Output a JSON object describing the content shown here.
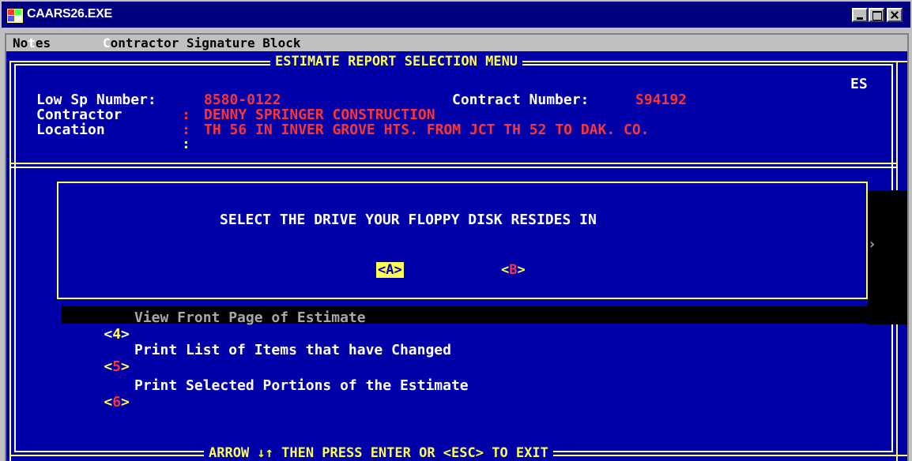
{
  "window": {
    "title": "CAARS26.EXE",
    "icon": "ms-dos-icon",
    "controls": [
      "minimize",
      "maximize",
      "close"
    ]
  },
  "menubar": {
    "notes": {
      "before": "No",
      "hotkey": "t",
      "after": "es"
    },
    "signature": {
      "hotkey": "C",
      "after": "ontractor Signature Block"
    }
  },
  "screen": {
    "title": " ESTIMATE REPORT SELECTION MENU ",
    "code": "ES",
    "footer": " ARROW ↓↑ THEN PRESS ENTER OR <ESC> TO EXIT "
  },
  "header": {
    "low_sp_label": "Low Sp Number:",
    "low_sp_value": "8580-0122",
    "contract_label": "Contract Number:",
    "contract_value": "S94192",
    "contractor_label": "Contractor",
    "contractor_sep": ":",
    "contractor_value": "DENNY SPRINGER CONSTRUCTION",
    "location_label": "Location",
    "location_sep": ":",
    "location_value": "TH 56 IN INVER GROVE HTS. FROM JCT TH 52 TO DAK. CO.",
    "extra_sep": ":"
  },
  "dialog": {
    "prompt": "SELECT THE DRIVE YOUR FLOPPY DISK RESIDES IN",
    "option_a": {
      "open": "<",
      "key": "A",
      "close": ">"
    },
    "option_b": {
      "open": "<",
      "key": "B",
      "close": ">"
    }
  },
  "menu_items": [
    {
      "open": "<",
      "key": "4",
      "close": ">",
      "label": "View Front Page of Estimate",
      "state": "disabled"
    },
    {
      "open": "<",
      "key": "5",
      "close": ">",
      "label": "Print List of Items that have Changed"
    },
    {
      "open": "<",
      "key": "6",
      "close": ">",
      "label": "Print Selected Portions of the Estimate"
    }
  ],
  "colors": {
    "background": "#0000a8",
    "border": "#fcfc54",
    "value_text": "#fc3434",
    "label_text": "#ffffff",
    "titlebar": "#000080"
  }
}
